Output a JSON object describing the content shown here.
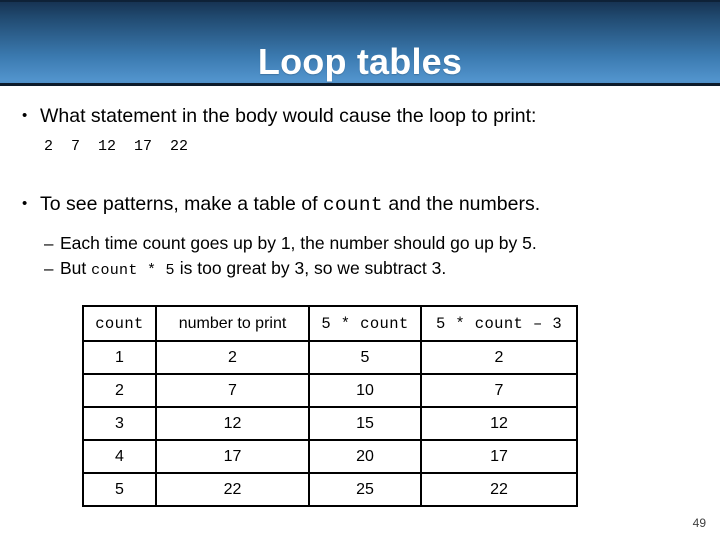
{
  "slide": {
    "title": "Loop tables",
    "number": "49",
    "banner_gradient_top": "#15304f",
    "banner_gradient_bottom": "#5294cd",
    "accent_blue": "#1f4e79"
  },
  "bullets": {
    "bullet_mark": "•",
    "sub_bullet_mark": "–",
    "first": {
      "text": "What statement in the body would cause the loop to print:",
      "code_sample": "2  7  12  17  22"
    },
    "second": {
      "text_before_code": "To see patterns, make a table of ",
      "code": "count",
      "text_after_code": " and the numbers.",
      "sub_items": [
        {
          "text_before_code": "Each time count goes up by 1, the number should go up by 5.",
          "code": "",
          "text_after_code": ""
        },
        {
          "text_before_code": "But ",
          "code": "count * 5",
          "text_after_code": " is too great by 3, so we subtract 3."
        }
      ]
    }
  },
  "table": {
    "headers": [
      {
        "label": "count",
        "style": "mono",
        "color": "black"
      },
      {
        "label": "number to print",
        "style": "sans",
        "color": "black"
      },
      {
        "label": "5 * count",
        "style": "mono",
        "color": "black"
      },
      {
        "label": "5 * count – 3",
        "style": "mono",
        "color": "blue"
      }
    ],
    "rows": [
      {
        "count": "1",
        "number_to_print": "2",
        "five_times_count": "5",
        "five_times_count_minus_3": "2"
      },
      {
        "count": "2",
        "number_to_print": "7",
        "five_times_count": "10",
        "five_times_count_minus_3": "7"
      },
      {
        "count": "3",
        "number_to_print": "12",
        "five_times_count": "15",
        "five_times_count_minus_3": "12"
      },
      {
        "count": "4",
        "number_to_print": "17",
        "five_times_count": "20",
        "five_times_count_minus_3": "17"
      },
      {
        "count": "5",
        "number_to_print": "22",
        "five_times_count": "25",
        "five_times_count_minus_3": "22"
      }
    ]
  }
}
